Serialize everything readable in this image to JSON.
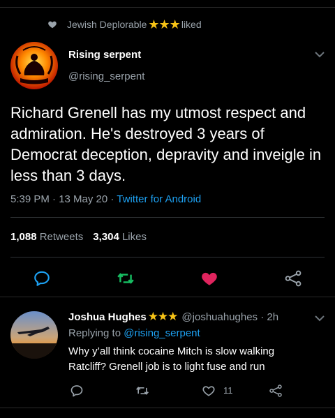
{
  "social_context": {
    "user": "Jewish Deplorable",
    "stars": "★★★",
    "action": "liked"
  },
  "tweet": {
    "author_name": "Rising serpent",
    "author_handle": "@rising_serpent",
    "text": "Richard Grenell has my utmost respect and admiration. He's destroyed 3 years of Democrat deception, depravity and inveigle in less than 3 days.",
    "time": "5:39 PM · 13 May 20 · ",
    "source": "Twitter for Android",
    "retweets_count": "1,088",
    "retweets_label": "Retweets",
    "likes_count": "3,304",
    "likes_label": "Likes",
    "liked": true
  },
  "reply": {
    "author_name": "Joshua Hughes",
    "stars": "★★★",
    "handle_time": "@joshuahughes · 2h",
    "replying_to_label": "Replying to",
    "replying_to_handle": "@rising_serpent",
    "text": "Why y’all think cocaine Mitch is slow walking Ratcliff? Grenell job is to light fuse and run",
    "like_count": "11"
  },
  "colors": {
    "accent": "#1da1f2",
    "retweet_green": "#17bf63",
    "like_pink": "#e0245e",
    "star_gold": "#f7c316"
  },
  "icons": [
    "heart-icon",
    "chevron-down-icon",
    "reply-icon",
    "retweet-icon",
    "like-icon",
    "share-icon"
  ]
}
